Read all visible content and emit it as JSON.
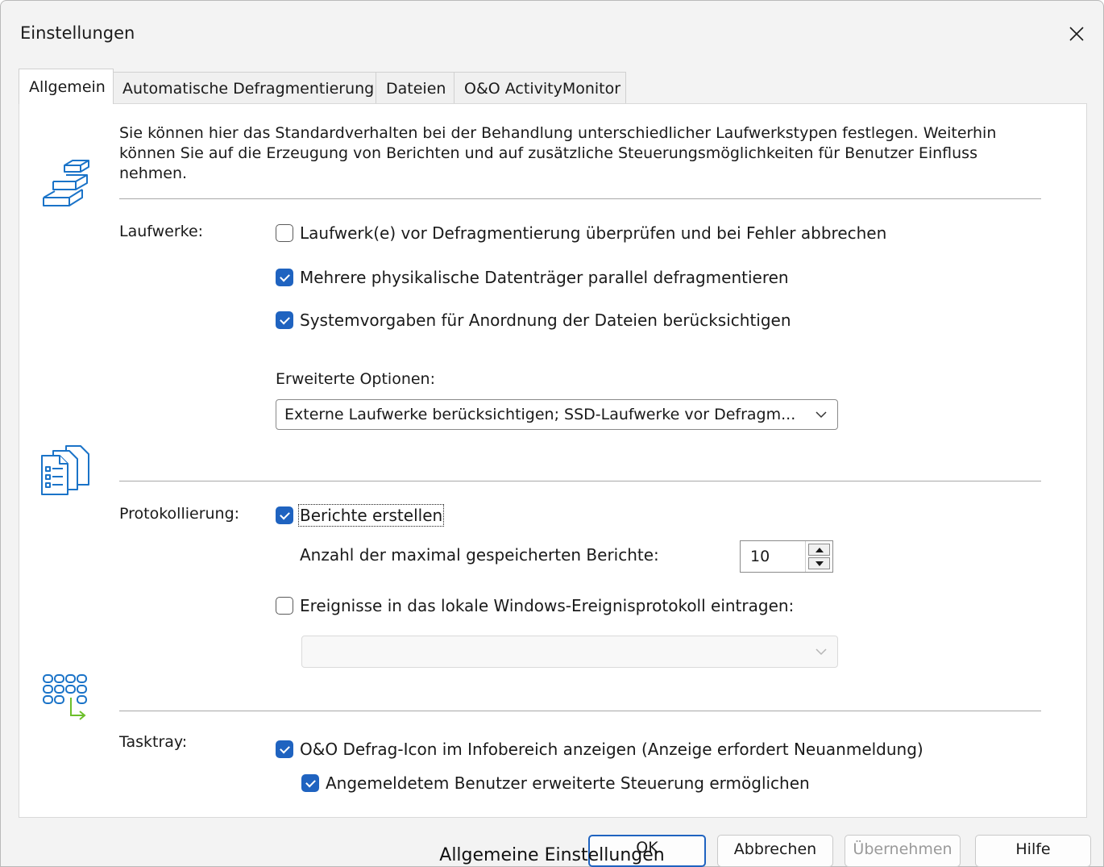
{
  "window": {
    "title": "Einstellungen"
  },
  "tabs": [
    {
      "label": "Allgemein",
      "active": true
    },
    {
      "label": "Automatische Defragmentierung",
      "active": false
    },
    {
      "label": "Dateien",
      "active": false
    },
    {
      "label": "O&O ActivityMonitor",
      "active": false
    }
  ],
  "intro": "Sie können hier das Standardverhalten bei der Behandlung unterschiedlicher Laufwerkstypen festlegen. Weiterhin können Sie auf die Erzeugung von Berichten und auf zusätzliche Steuerungsmöglichkeiten für Benutzer Einfluss nehmen.",
  "laufwerke": {
    "label": "Laufwerke:",
    "options": [
      {
        "label": "Laufwerk(e) vor Defragmentierung überprüfen und bei Fehler abbrechen",
        "checked": false
      },
      {
        "label": "Mehrere physikalische Datenträger parallel defragmentieren",
        "checked": true
      },
      {
        "label": "Systemvorgaben für Anordnung der Dateien berücksichtigen",
        "checked": true
      }
    ],
    "advanced_label": "Erweiterte Optionen:",
    "advanced_value": "Externe Laufwerke berücksichtigen; SSD-Laufwerke vor Defragm..."
  },
  "protokoll": {
    "label": "Protokollierung:",
    "reports": {
      "label": "Berichte erstellen",
      "checked": true
    },
    "max_label": "Anzahl der maximal gespeicherten Berichte:",
    "max_value": "10",
    "events": {
      "label": "Ereignisse in das lokale Windows-Ereignisprotokoll eintragen:",
      "checked": false
    },
    "events_value": ""
  },
  "tasktray": {
    "label": "Tasktray:",
    "show_icon": {
      "label": "O&O Defrag-Icon im Infobereich anzeigen (Anzeige erfordert Neuanmeldung)",
      "checked": true
    },
    "user_control": {
      "label": "Angemeldetem Benutzer erweiterte Steuerung ermöglichen",
      "checked": true
    }
  },
  "buttons": {
    "ok": "OK",
    "cancel": "Abbrechen",
    "apply": "Übernehmen",
    "help": "Hilfe"
  },
  "caption": "Allgemeine Einstellungen",
  "colors": {
    "accent": "#1f63c0",
    "icon": "#1a73c8",
    "arrow": "#6cbf2a"
  },
  "icons": [
    "close-icon",
    "drives-stack-icon",
    "report-pages-icon",
    "tray-grid-icon",
    "chevron-down-icon"
  ]
}
